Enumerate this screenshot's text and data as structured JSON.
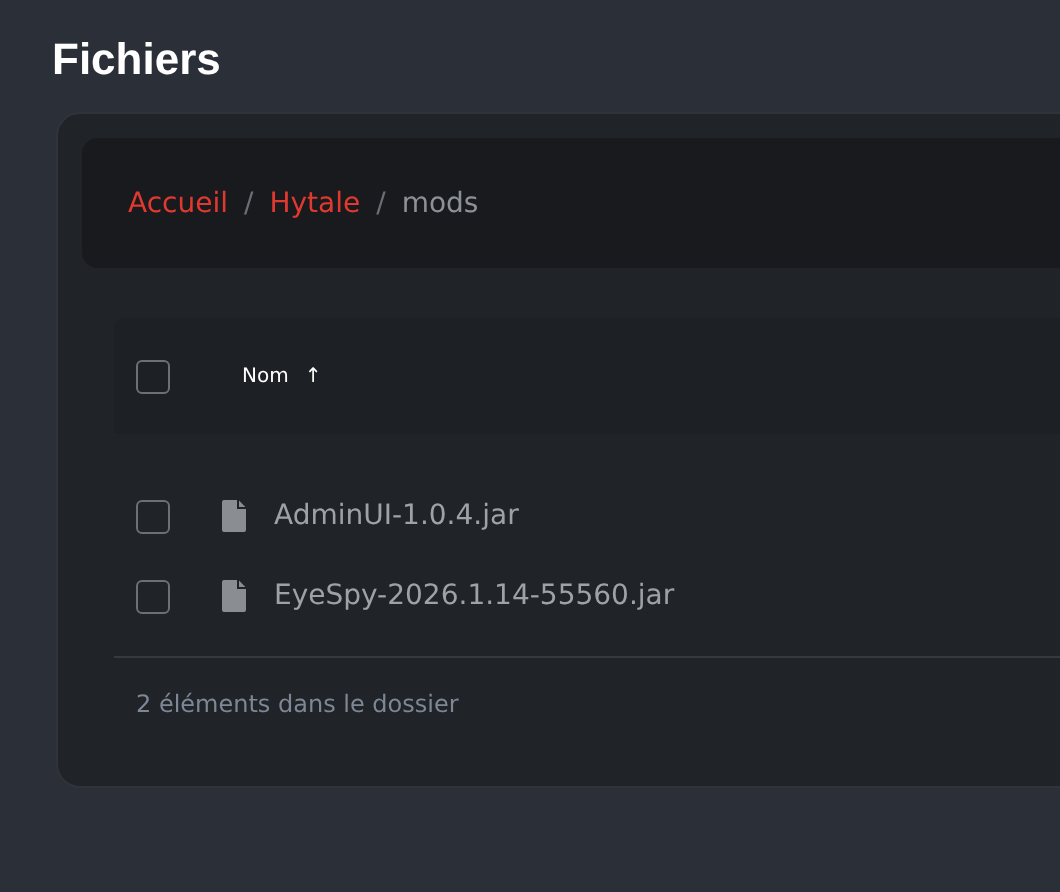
{
  "page_title": "Fichiers",
  "breadcrumb": [
    {
      "label": "Accueil",
      "kind": "link"
    },
    {
      "label": "Hytale",
      "kind": "link"
    },
    {
      "label": "mods",
      "kind": "current"
    }
  ],
  "breadcrumb_separator": "/",
  "table": {
    "select_all": {
      "checked": false
    },
    "columns": [
      {
        "label": "Nom",
        "sort_icon": "↑"
      }
    ],
    "rows": [
      {
        "name": "AdminUI-1.0.4.jar",
        "checked": false
      },
      {
        "name": "EyeSpy-2026.1.14-55560.jar",
        "checked": false
      }
    ]
  },
  "footer": "2 éléments dans le dossier"
}
